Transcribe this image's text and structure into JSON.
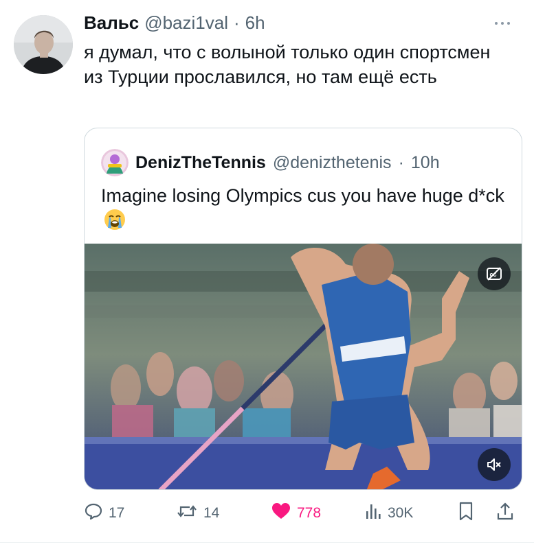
{
  "tweet": {
    "author": {
      "display_name": "Вальс",
      "handle": "@bazi1val",
      "separator": "·",
      "time": "6h"
    },
    "text": "я думал, что с волыной только один спортсмен из Турции прославился, но там ещё есть",
    "quoted": {
      "author": {
        "display_name": "DenizTheTennis",
        "handle": "@denizthetenis",
        "separator": "·",
        "time": "10h"
      },
      "text": "Imagine losing Olympics cus you have huge d*ck",
      "emoji_icon": "loudly-crying-face-icon",
      "media": {
        "type": "video",
        "captions_icon": "captions-off-icon",
        "sound_icon": "muted-speaker-icon"
      }
    },
    "actions": {
      "replies": "17",
      "reposts": "14",
      "likes": "778",
      "views": "30K",
      "liked": true
    },
    "colors": {
      "text": "#0f1419",
      "secondary": "#536471",
      "like": "#f91880",
      "border": "#cfd9de"
    }
  }
}
